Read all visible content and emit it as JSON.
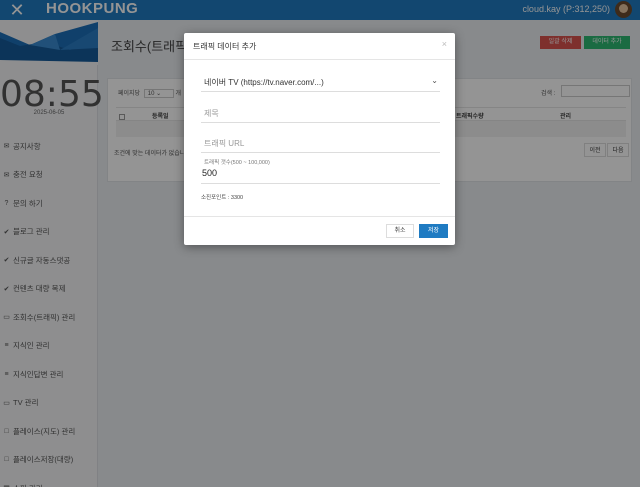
{
  "topbar": {
    "brand": "HOOKPUNG",
    "user": "cloud.kay (P:312,250)",
    "close_icon": "close-icon"
  },
  "sidebar": {
    "clock": "08:55",
    "date": "2025-06-05",
    "items": [
      {
        "icon": "✉",
        "label": "공지사항"
      },
      {
        "icon": "✉",
        "label": "충전 요청"
      },
      {
        "icon": "?",
        "label": "문의 하기"
      },
      {
        "icon": "✔",
        "label": "블로그 관리"
      },
      {
        "icon": "✔",
        "label": "신규글 자동스댓공"
      },
      {
        "icon": "✔",
        "label": "컨텐츠 대량 복제"
      },
      {
        "icon": "▭",
        "label": "조회수(트래픽) 관리"
      },
      {
        "icon": "≡",
        "label": "지식인 관리"
      },
      {
        "icon": "≡",
        "label": "지식인답변 관리"
      },
      {
        "icon": "▭",
        "label": "TV 관리"
      },
      {
        "icon": "□",
        "label": "플레이스(지도) 관리"
      },
      {
        "icon": "□",
        "label": "플레이스저장(대량)"
      },
      {
        "icon": "▦",
        "label": "쇼핑 관리"
      }
    ]
  },
  "main": {
    "title": "조회수(트래픽) 관",
    "btn_delete": "일괄 삭제",
    "btn_add": "데이터 추가",
    "per_page_label": "페이지당",
    "per_page_value": "10",
    "per_page_suffix": "개",
    "search_label": "검색 :",
    "columns": [
      "등록일",
      "트래픽수량",
      "관리"
    ],
    "empty_message": "조건에 맞는 데이터가 없습니다",
    "prev": "이전",
    "next": "다음"
  },
  "modal": {
    "title": "트래픽 데이터 추가",
    "close": "×",
    "platform_selected": "네이버 TV (https://tv.naver.com/...)",
    "title_placeholder": "제목",
    "url_placeholder": "트래픽 URL",
    "count_label": "트래픽 갯수(500 ~ 100,000)",
    "count_value": "500",
    "points": "소진포인트 : 3300",
    "cancel": "취소",
    "save": "저장"
  },
  "colors": {
    "topbar": "#1f7bc2",
    "danger": "#d9534f",
    "success": "#2eb872",
    "primary": "#1f7bc2"
  }
}
